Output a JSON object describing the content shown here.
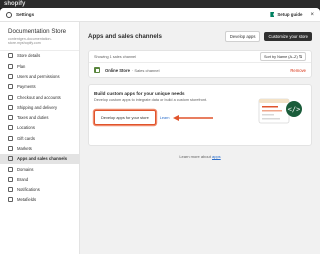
{
  "background_app": {
    "logo_text": "shopify"
  },
  "window": {
    "title": "Settings",
    "setup_guide_label": "Setup guide",
    "close_label": "×"
  },
  "store": {
    "name": "Documentation Store",
    "url": "contentgen-documentation-store.myshopify.com"
  },
  "sidebar": {
    "items": [
      {
        "label": "Store details",
        "icon": "store-icon"
      },
      {
        "label": "Plan",
        "icon": "plan-icon"
      },
      {
        "label": "Users and permissions",
        "icon": "users-icon"
      },
      {
        "label": "Payments",
        "icon": "payments-icon"
      },
      {
        "label": "Checkout and accounts",
        "icon": "checkout-icon"
      },
      {
        "label": "Shipping and delivery",
        "icon": "shipping-icon"
      },
      {
        "label": "Taxes and duties",
        "icon": "taxes-icon"
      },
      {
        "label": "Locations",
        "icon": "location-icon"
      },
      {
        "label": "Gift cards",
        "icon": "gift-card-icon"
      },
      {
        "label": "Markets",
        "icon": "markets-icon"
      },
      {
        "label": "Apps and sales channels",
        "icon": "apps-icon",
        "active": true
      },
      {
        "label": "Domains",
        "icon": "domains-icon"
      },
      {
        "label": "Brand",
        "icon": "brand-icon"
      },
      {
        "label": "Notifications",
        "icon": "bell-icon"
      },
      {
        "label": "Metafields",
        "icon": "metafields-icon"
      }
    ]
  },
  "main": {
    "title": "Apps and sales channels",
    "develop_apps_label": "Develop apps",
    "customize_store_label": "Customize your store",
    "showing_text": "Showing 1 sales channel",
    "sort_label": "Sort by Name (A–Z) ⇅",
    "channel": {
      "name": "Online Store",
      "subtitle": "· Sales channel",
      "remove_label": "Remove"
    },
    "custom_apps": {
      "title": "Build custom apps for your unique needs",
      "description": "Develop custom apps to integrate data or build a custom storefront.",
      "button_label": "Develop apps for your store",
      "learn_more_label": "Learn"
    },
    "footer": {
      "prefix": "Learn more about ",
      "link_label": "apps"
    }
  },
  "colors": {
    "annotation_arrow": "#e0542c",
    "primary_button": "#303030",
    "remove_text": "#d72c0d",
    "link": "#2c6ecb"
  }
}
